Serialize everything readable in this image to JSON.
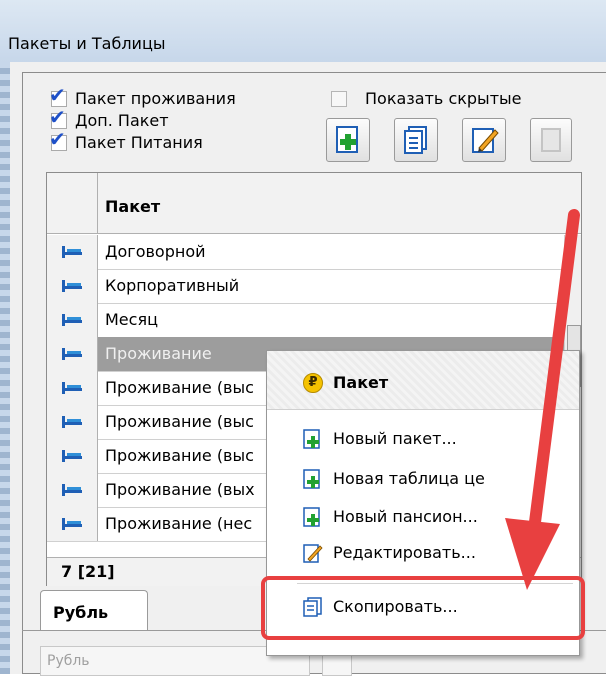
{
  "window": {
    "title": "Пакеты и Таблицы"
  },
  "filters": {
    "checkboxes": [
      {
        "label": "Пакет проживания",
        "checked": true
      },
      {
        "label": "Доп. Пакет",
        "checked": true
      },
      {
        "label": "Пакет Питания",
        "checked": true
      }
    ],
    "show_hidden": {
      "label": "Показать скрытые",
      "checked": false
    }
  },
  "toolbar": {
    "buttons": [
      {
        "icon": "add-document-icon"
      },
      {
        "icon": "copy-document-icon"
      },
      {
        "icon": "edit-document-icon"
      },
      {
        "icon": "disabled-document-icon"
      }
    ]
  },
  "grid": {
    "column_header": "Пакет",
    "rows": [
      "Договорной",
      "Корпоративный",
      "Месяц",
      "Проживание",
      "Проживание (выс",
      "Проживание (выс",
      "Проживание (выс",
      "Проживание (вых",
      "Проживание (нес"
    ],
    "selected_row": "Проживание",
    "footer_count": "7 [21]"
  },
  "tabs": {
    "active": "Рубль"
  },
  "bottom_field": {
    "placeholder": "Рубль"
  },
  "context_menu": {
    "header": "Пакет",
    "items": [
      "Новый пакет...",
      "Новая таблица це",
      "Новый пансион...",
      "Редактировать...",
      "Скопировать..."
    ]
  },
  "colors": {
    "annotation": "#e84040",
    "selection": "#9d9d9d"
  }
}
